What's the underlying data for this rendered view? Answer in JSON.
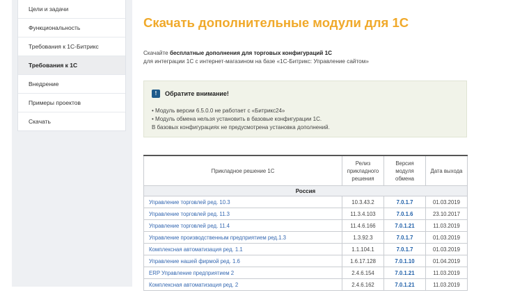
{
  "sidebar": {
    "items": [
      {
        "label": "Цели и задачи",
        "active": false
      },
      {
        "label": "Функциональность",
        "active": false
      },
      {
        "label": "Требования к 1С-Битрикс",
        "active": false
      },
      {
        "label": "Требования к 1С",
        "active": true
      },
      {
        "label": "Внедрение",
        "active": false
      },
      {
        "label": "Примеры проектов",
        "active": false
      },
      {
        "label": "Скачать",
        "active": false
      }
    ]
  },
  "main": {
    "title": "Скачать дополнительные модули для 1С",
    "intro_prefix": "Скачайте ",
    "intro_bold": "бесплатные дополнения для торговых конфигураций 1С",
    "intro_line2": "для интеграции 1С с интернет-магазином на базе «1С-Битрикс: Управление сайтом»"
  },
  "notice": {
    "icon": "exclamation-icon",
    "title": "Обратите внимание!",
    "lines": [
      "•  Модуль версии 6.5.0.0 не работает с «Битрикс24»",
      "•  Модуль обмена нельзя установить в базовые конфигурации 1С.",
      "В базовых конфигурациях не предусмотрена установка дополнений."
    ]
  },
  "table": {
    "headers": {
      "solution": "Прикладное решение 1С",
      "release": "Релиз прикладного решения",
      "version": "Версия модуля обмена",
      "date": "Дата выхода"
    },
    "group": "Россия",
    "rows": [
      {
        "name": "Управление торговлей ред. 10.3",
        "release": "10.3.43.2",
        "version": "7.0.1.7",
        "date": "01.03.2019"
      },
      {
        "name": "Управление торговлей ред. 11.3",
        "release": "11.3.4.103",
        "version": "7.0.1.6",
        "date": "23.10.2017"
      },
      {
        "name": "Управление торговлей ред. 11.4",
        "release": "11.4.6.166",
        "version": "7.0.1.21",
        "date": "11.03.2019"
      },
      {
        "name": "Управление производственным предприятием ред.1.3",
        "release": "1.3.92.3",
        "version": "7.0.1.7",
        "date": "01.03.2019"
      },
      {
        "name": "Комплексная автоматизация ред. 1.1",
        "release": "1.1.104.1",
        "version": "7.0.1.7",
        "date": "01.03.2019"
      },
      {
        "name": "Управление нашей фирмой ред. 1.6",
        "release": "1.6.17.128",
        "version": "7.0.1.10",
        "date": "01.04.2019"
      },
      {
        "name": "ERP Управление предприятием 2",
        "release": "2.4.6.154",
        "version": "7.0.1.21",
        "date": "11.03.2019"
      },
      {
        "name": "Комплексная автоматизация ред. 2",
        "release": "2.4.6.162",
        "version": "7.0.1.21",
        "date": "11.03.2019"
      }
    ]
  }
}
